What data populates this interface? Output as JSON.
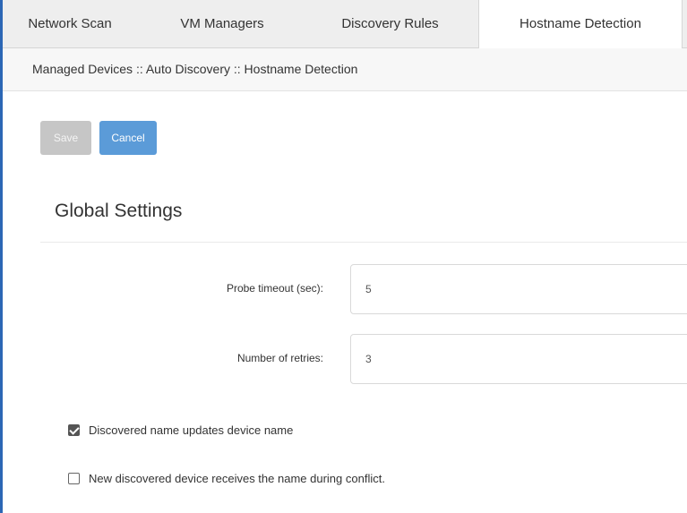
{
  "tabs": [
    {
      "label": "Network Scan",
      "active": false
    },
    {
      "label": "VM Managers",
      "active": false
    },
    {
      "label": "Discovery Rules",
      "active": false
    },
    {
      "label": "Hostname Detection",
      "active": true
    }
  ],
  "breadcrumb": "Managed Devices :: Auto Discovery :: Hostname Detection",
  "actions": {
    "save_label": "Save",
    "cancel_label": "Cancel"
  },
  "section": {
    "title": "Global Settings"
  },
  "fields": [
    {
      "label": "Probe timeout (sec):",
      "value": "5"
    },
    {
      "label": "Number of retries:",
      "value": "3"
    }
  ],
  "checkboxes": [
    {
      "label": "Discovered name updates device name",
      "checked": true
    },
    {
      "label": "New discovered device receives the name during conflict.",
      "checked": false
    }
  ],
  "colors": {
    "accent": "#5b9bd8",
    "left_border": "#2c67b5",
    "disabled": "#c6c6c6"
  }
}
